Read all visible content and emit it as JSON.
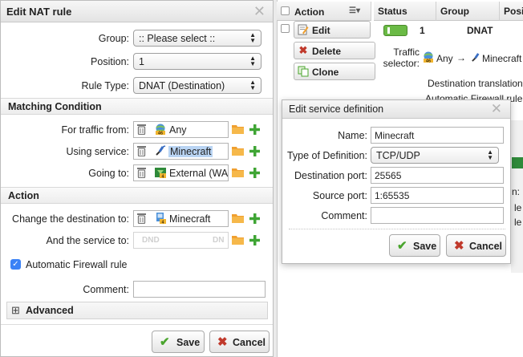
{
  "nat_dialog": {
    "title": "Edit NAT rule",
    "close_glyph": "✕",
    "group_label": "Group:",
    "group_value": ":: Please select ::",
    "position_label": "Position:",
    "position_value": "1",
    "rule_type_label": "Rule Type:",
    "rule_type_value": "DNAT (Destination)",
    "matching_header": "Matching Condition",
    "traffic_from_label": "For traffic from:",
    "traffic_from_value": "Any",
    "using_service_label": "Using service:",
    "using_service_value": "Minecraft",
    "going_to_label": "Going to:",
    "going_to_value": "External (WAN)",
    "action_header": "Action",
    "change_dest_label": "Change the destination to:",
    "change_dest_value": "Minecraft",
    "service_to_label": "And the service to:",
    "service_to_placeholder_left": "DND",
    "service_to_placeholder_right": "DN",
    "auto_fw_label": "Automatic Firewall rule",
    "comment_label": "Comment:",
    "comment_value": "",
    "advanced_label": "Advanced",
    "advanced_expander": "⊞",
    "save_label": "Save",
    "cancel_label": "Cancel"
  },
  "rules_table": {
    "columns": [
      "Action",
      "Status",
      "Group",
      "Posit"
    ],
    "edit_label": "Edit",
    "delete_label": "Delete",
    "clone_label": "Clone",
    "position_number": "1",
    "group_value": "DNAT",
    "traffic_selector_label_1": "Traffic",
    "traffic_selector_label_2": "selector:",
    "traffic_any": "Any",
    "arrow": "→",
    "traffic_service": "Minecraft",
    "dest_translation_text": "Destination translation",
    "auto_fw_text": "Automatic Firewall rule",
    "partial_right_1": "n:",
    "partial_right_2": "le",
    "partial_right_3": "le"
  },
  "service_dialog": {
    "title": "Edit service definition",
    "close_glyph": "✕",
    "name_label": "Name:",
    "name_value": "Minecraft",
    "type_label": "Type of Definition:",
    "type_value": "TCP/UDP",
    "dest_port_label": "Destination port:",
    "dest_port_value": "25565",
    "src_port_label": "Source port:",
    "src_port_value": "1:65535",
    "comment_label": "Comment:",
    "comment_value": "",
    "save_label": "Save",
    "cancel_label": "Cancel"
  },
  "colors": {
    "save_check": "#4aa52e",
    "cancel_x": "#c0392b",
    "folder": "#f0a030",
    "plus": "#3fa534",
    "highlight": "#b9d4f3",
    "checkbox": "#3b82f6",
    "toggle": "#6aba45"
  }
}
